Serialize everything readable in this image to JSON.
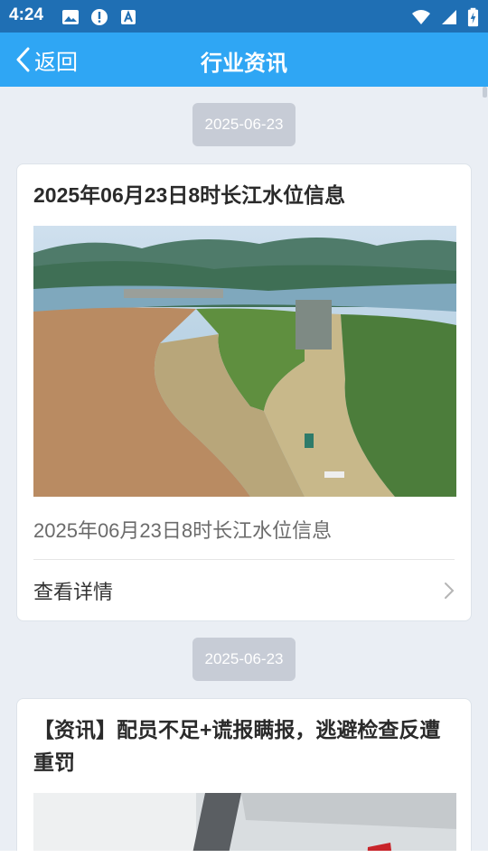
{
  "status_bar": {
    "time": "4:24",
    "left_icons": [
      "image-icon",
      "alert-icon",
      "keyboard-a-icon"
    ],
    "right_icons": [
      "wifi-icon",
      "signal-icon",
      "battery-charging-icon"
    ]
  },
  "app_bar": {
    "back_label": "返回",
    "title": "行业资讯",
    "color": "#2fa6f4"
  },
  "feed": [
    {
      "date": "2025-06-23",
      "title": "2025年06月23日8时长江水位信息",
      "summary": "2025年06月23日8时长江水位信息",
      "detail_label": "查看详情",
      "image": "three-gorges-dam-aerial-photo"
    },
    {
      "date": "2025-06-23",
      "title": "【资讯】配员不足+谎报瞒报，逃避检查反遭重罚",
      "image": "ship-bridge-photo"
    }
  ]
}
